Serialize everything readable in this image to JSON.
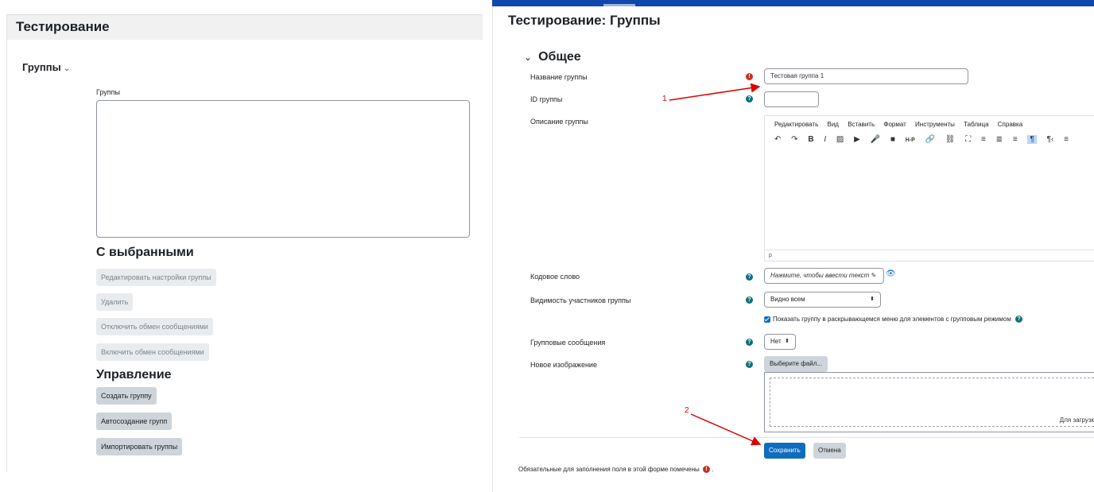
{
  "left": {
    "title": "Тестирование",
    "groups_dropdown": "Группы",
    "groups_chevron": "⌄",
    "groups_list_label": "Группы",
    "with_selected_heading": "С выбранными",
    "with_selected_buttons": [
      "Редактировать настройки группы",
      "Удалить",
      "Отключить обмен сообщениями",
      "Включить обмен сообщениями"
    ],
    "manage_heading": "Управление",
    "manage_buttons": [
      "Создать группу",
      "Автосоздание групп",
      "Импортировать группы"
    ]
  },
  "right": {
    "title": "Тестирование: Группы",
    "section": "Общее",
    "section_chevron": "⌄",
    "fields": {
      "group_name_label": "Название группы",
      "group_name_value": "Тестовая группа 1",
      "group_id_label": "ID группы",
      "group_id_value": "",
      "description_label": "Описание группы",
      "enrol_key_label": "Кодовое слово",
      "enrol_key_placeholder": "Нажмите, чтобы ввести текст",
      "visibility_label": "Видимость участников группы",
      "visibility_value": "Видно всем",
      "show_in_dropdown_label": "Показать группу в раскрывающемся меню для элементов с групповым режимом",
      "messaging_label": "Групповые сообщения",
      "messaging_value": "Нет",
      "new_image_label": "Новое изображение",
      "choose_file_button": "Выберите файл...",
      "drop_text": "Для загрузк"
    },
    "editor": {
      "menu": [
        "Редактировать",
        "Вид",
        "Вставить",
        "Формат",
        "Инструменты",
        "Таблица",
        "Справка"
      ],
      "toolbar": [
        "↶",
        "↷",
        "B",
        "I",
        "▨",
        "▶",
        "🎤",
        "■",
        "H-P",
        "🔗",
        "⛓",
        "⛶",
        "≡",
        "≣",
        "≡",
        "¶",
        "¶‹",
        "≡"
      ],
      "statusbar": "p"
    },
    "buttons": {
      "save": "Сохранить",
      "cancel": "Отмена"
    },
    "required_note": "Обязательные для заполнения поля в этой форме помечены",
    "required_note_end": ".",
    "required_icon": "!",
    "help_icon": "?",
    "annotations": [
      "1",
      "2"
    ]
  },
  "colors": {
    "top_bar": "#0f47ad",
    "primary": "#0f6cbf",
    "required": "#ca3120",
    "help": "#0f6e7e",
    "annotation": "#dd0000"
  },
  "icons": {
    "required": "exclamation-circle-icon",
    "help": "question-circle-icon",
    "pencil": "pencil-icon",
    "eye": "eye-icon"
  }
}
